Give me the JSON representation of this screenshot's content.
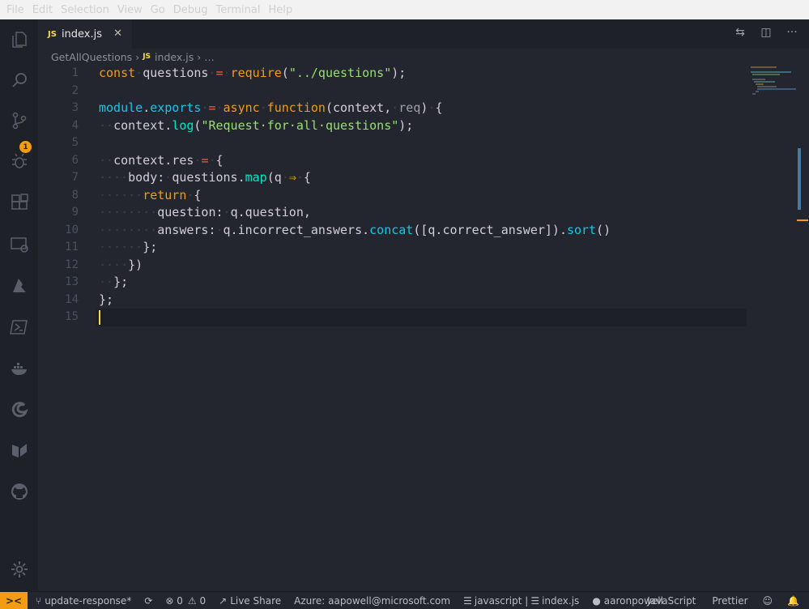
{
  "menubar": {
    "items": [
      "File",
      "Edit",
      "Selection",
      "View",
      "Go",
      "Debug",
      "Terminal",
      "Help"
    ]
  },
  "activity_bar": {
    "icons": [
      "explorer-icon",
      "search-icon",
      "source-control-icon",
      "debug-icon",
      "extensions-icon",
      "remote-explorer-icon",
      "azure-icon",
      "powershell-icon",
      "docker-icon",
      "edge-icon",
      "live-share-icon",
      "github-icon",
      "settings-gear-icon"
    ],
    "scm_badge": "1"
  },
  "tab": {
    "icon_text": "JS",
    "label": "index.js",
    "close": "✕"
  },
  "tab_actions": {
    "compare": "⇆",
    "split": "◫",
    "more": "···"
  },
  "breadcrumbs": {
    "folder": "GetAllQuestions",
    "sep": "›",
    "js": "JS",
    "file": "index.js",
    "ellipsis": "…"
  },
  "editor": {
    "line_numbers": [
      "1",
      "2",
      "3",
      "4",
      "5",
      "6",
      "7",
      "8",
      "9",
      "10",
      "11",
      "12",
      "13",
      "14",
      "15"
    ],
    "colors": {
      "keyword": "#f39c12",
      "string": "#96e072",
      "function": "#00e8c6",
      "module": "#17c6e8",
      "operator": "#ee5d43",
      "cursor": "#f9d949"
    }
  },
  "statusbar": {
    "remote": "><",
    "branch": "update-response*",
    "sync": "⟳",
    "errors": "⊗ 0",
    "warnings": "⚠ 0",
    "live_share": "Live Share",
    "azure": "Azure: aapowell@microsoft.com",
    "language_scope": "javascript | ",
    "file_scope": "index.js",
    "github_user": "aaronpowell",
    "language": "JavaScript",
    "formatter": "Prettier",
    "feedback": "☺",
    "bell": "🔔"
  }
}
